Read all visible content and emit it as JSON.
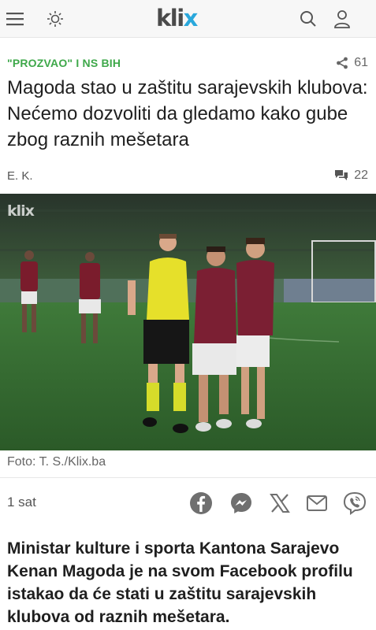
{
  "header": {
    "logo_text": "kli",
    "logo_x": "x",
    "icons": [
      "menu-icon",
      "brightness-icon",
      "search-icon",
      "user-icon"
    ]
  },
  "article": {
    "category": "\"PROZVAO\" I NS BIH",
    "share_count": "61",
    "title": "Magoda stao u zaštitu sarajevskih klubova: Nećemo dozvoliti da gledamo kako gube zbog raznih mešetara",
    "author": "E. K.",
    "comment_count": "22",
    "photo": {
      "watermark": "klix",
      "caption": "Foto: T. S./Klix.ba"
    },
    "time": "1 sat",
    "share_buttons": [
      "facebook-icon",
      "messenger-icon",
      "x-icon",
      "email-icon",
      "viber-icon"
    ],
    "lead": "Ministar kulture i sporta Kantona Sarajevo Kenan Magoda je na svom Facebook profilu istakao da će stati u zaštitu sarajevskih klubova od raznih mešetara."
  },
  "colors": {
    "category_green": "#3ea84a",
    "logo_blue": "#2aa8dc",
    "icon_gray": "#6f6f6f"
  }
}
